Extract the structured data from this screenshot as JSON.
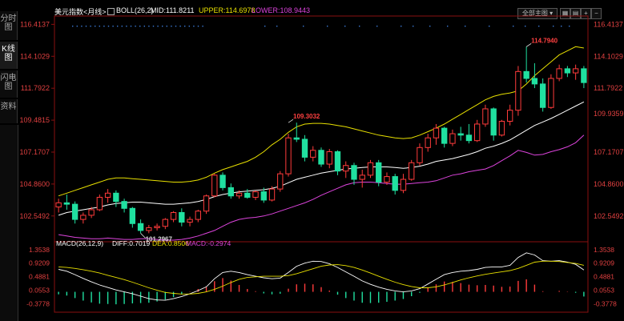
{
  "sidebar": {
    "tabs": [
      {
        "label": "分时图",
        "active": false
      },
      {
        "label": "K线图",
        "active": true
      },
      {
        "label": "闪电图",
        "active": false
      },
      {
        "label": "资料",
        "active": false
      }
    ]
  },
  "header": {
    "symbol": "美元指数<月线>",
    "indicator": "BOLL(26,2)",
    "mid_label": "MID:111.8211",
    "upper_label": "UPPER:114.6978",
    "lower_label": "LOWER:108.9443",
    "dropdown": "全部主图",
    "colors": {
      "mid": "#ffffff",
      "upper": "#e8e000",
      "lower": "#dd44dd"
    }
  },
  "toolbar": {
    "icons": [
      "grid-icon",
      "book-icon",
      "zoom-in-icon",
      "zoom-out-icon"
    ]
  },
  "chart_data": [
    {
      "type": "candlestick",
      "ylim": [
        100.8,
        116.9
      ],
      "yticks_left": [
        "116.4137",
        "114.1029",
        "111.7922",
        "109.4815",
        "107.1707",
        "104.8600",
        "102.5492"
      ],
      "yticks_right": [
        "116.4137",
        "114.1029",
        "111.7922",
        "109.9359",
        "107.1707",
        "104.8600",
        "102.5492"
      ],
      "annotations": [
        {
          "text": "114.7940",
          "index": 57,
          "value": 114.794
        },
        {
          "text": "109.3032",
          "index": 28,
          "value": 109.3032
        },
        {
          "text": "101.2967",
          "index": 10,
          "value": 101.2967
        }
      ],
      "colors": {
        "up": "#ff3b3b",
        "down": "#20e0a0"
      },
      "candles": [
        [
          103.2,
          103.8,
          102.8,
          103.5
        ],
        [
          103.5,
          104.1,
          103.0,
          103.4
        ],
        [
          103.4,
          103.6,
          102.0,
          102.3
        ],
        [
          102.3,
          102.8,
          102.0,
          102.6
        ],
        [
          102.6,
          103.2,
          102.4,
          103.0
        ],
        [
          103.0,
          104.1,
          102.9,
          103.9
        ],
        [
          103.9,
          104.5,
          103.5,
          104.2
        ],
        [
          104.2,
          104.4,
          103.2,
          103.6
        ],
        [
          103.6,
          103.8,
          102.8,
          103.1
        ],
        [
          103.1,
          103.2,
          101.7,
          102.0
        ],
        [
          102.0,
          102.3,
          101.3,
          101.5
        ],
        [
          101.5,
          101.9,
          101.3,
          101.7
        ],
        [
          101.7,
          102.0,
          101.5,
          101.8
        ],
        [
          101.8,
          102.4,
          101.6,
          102.3
        ],
        [
          102.3,
          102.9,
          102.1,
          102.8
        ],
        [
          102.8,
          103.1,
          101.8,
          102.1
        ],
        [
          102.1,
          102.5,
          101.8,
          102.3
        ],
        [
          102.3,
          103.0,
          102.1,
          102.9
        ],
        [
          102.9,
          104.1,
          102.7,
          104.0
        ],
        [
          104.0,
          105.6,
          103.9,
          105.5
        ],
        [
          105.5,
          105.7,
          104.4,
          104.6
        ],
        [
          104.6,
          104.9,
          103.8,
          104.0
        ],
        [
          104.0,
          104.4,
          103.8,
          104.2
        ],
        [
          104.2,
          104.5,
          103.8,
          103.9
        ],
        [
          103.9,
          104.4,
          103.7,
          104.3
        ],
        [
          104.3,
          104.6,
          103.5,
          103.7
        ],
        [
          103.7,
          104.7,
          103.6,
          104.5
        ],
        [
          104.5,
          105.8,
          104.3,
          105.6
        ],
        [
          105.6,
          108.5,
          105.4,
          108.2
        ],
        [
          108.2,
          109.3,
          107.9,
          108.1
        ],
        [
          108.1,
          108.4,
          106.5,
          106.8
        ],
        [
          106.8,
          107.6,
          106.5,
          107.3
        ],
        [
          107.3,
          107.5,
          106.1,
          106.3
        ],
        [
          106.3,
          107.4,
          106.0,
          107.2
        ],
        [
          107.2,
          107.3,
          105.5,
          105.8
        ],
        [
          105.8,
          106.5,
          105.3,
          106.2
        ],
        [
          106.2,
          106.4,
          104.8,
          105.2
        ],
        [
          105.2,
          105.9,
          104.6,
          105.5
        ],
        [
          105.5,
          106.6,
          105.3,
          106.4
        ],
        [
          106.4,
          106.6,
          104.7,
          105.0
        ],
        [
          105.0,
          105.7,
          104.8,
          105.4
        ],
        [
          105.4,
          105.6,
          104.1,
          104.4
        ],
        [
          104.4,
          105.6,
          104.2,
          105.2
        ],
        [
          105.2,
          106.6,
          105.1,
          106.4
        ],
        [
          106.4,
          107.8,
          106.2,
          107.5
        ],
        [
          107.5,
          108.5,
          107.2,
          108.2
        ],
        [
          108.2,
          109.2,
          107.7,
          108.9
        ],
        [
          108.9,
          109.0,
          107.5,
          107.8
        ],
        [
          107.8,
          108.8,
          107.6,
          108.5
        ],
        [
          108.5,
          109.0,
          108.0,
          108.4
        ],
        [
          108.4,
          109.2,
          107.8,
          108.0
        ],
        [
          108.0,
          109.5,
          107.9,
          109.2
        ],
        [
          109.2,
          110.6,
          109.0,
          110.3
        ],
        [
          110.3,
          110.4,
          108.0,
          108.4
        ],
        [
          108.4,
          109.5,
          108.3,
          109.4
        ],
        [
          109.4,
          110.6,
          109.1,
          110.2
        ],
        [
          110.2,
          113.4,
          109.8,
          113.0
        ],
        [
          113.0,
          114.8,
          112.2,
          112.5
        ],
        [
          112.5,
          113.6,
          111.8,
          112.1
        ],
        [
          112.1,
          112.5,
          110.1,
          110.4
        ],
        [
          110.4,
          112.8,
          110.3,
          112.5
        ],
        [
          112.5,
          113.5,
          112.3,
          113.2
        ],
        [
          113.2,
          113.4,
          112.6,
          112.9
        ],
        [
          112.9,
          113.5,
          112.4,
          113.2
        ],
        [
          113.2,
          113.4,
          111.8,
          112.2
        ]
      ],
      "boll_mid": [
        102.6,
        102.8,
        102.9,
        103.0,
        103.1,
        103.2,
        103.35,
        103.45,
        103.5,
        103.55,
        103.55,
        103.5,
        103.45,
        103.4,
        103.4,
        103.45,
        103.5,
        103.6,
        103.75,
        103.95,
        104.1,
        104.2,
        104.3,
        104.35,
        104.4,
        104.45,
        104.55,
        104.7,
        104.95,
        105.2,
        105.35,
        105.5,
        105.65,
        105.75,
        105.85,
        105.95,
        106.0,
        106.05,
        106.1,
        106.1,
        106.1,
        106.05,
        106.0,
        106.05,
        106.15,
        106.3,
        106.5,
        106.6,
        106.7,
        106.85,
        107.0,
        107.2,
        107.45,
        107.6,
        107.8,
        108.05,
        108.4,
        108.75,
        109.1,
        109.35,
        109.6,
        109.9,
        110.2,
        110.5,
        110.8
      ],
      "boll_upper": [
        104.0,
        104.2,
        104.4,
        104.6,
        104.8,
        105.0,
        105.2,
        105.3,
        105.3,
        105.25,
        105.2,
        105.15,
        105.1,
        105.05,
        105.0,
        105.0,
        105.05,
        105.15,
        105.35,
        105.65,
        105.9,
        106.1,
        106.3,
        106.5,
        106.8,
        107.2,
        107.7,
        108.1,
        108.6,
        109.0,
        109.2,
        109.25,
        109.25,
        109.2,
        109.1,
        109.0,
        108.85,
        108.7,
        108.55,
        108.4,
        108.3,
        108.2,
        108.15,
        108.2,
        108.4,
        108.65,
        108.9,
        109.2,
        109.55,
        109.9,
        110.25,
        110.6,
        110.95,
        111.2,
        111.35,
        111.45,
        111.6,
        112.1,
        112.7,
        113.2,
        113.7,
        114.2,
        114.5,
        114.8,
        114.7
      ],
      "boll_lower": [
        101.2,
        101.1,
        101.0,
        100.95,
        100.9,
        100.9,
        100.95,
        100.9,
        100.85,
        100.85,
        100.9,
        100.9,
        100.85,
        100.8,
        100.8,
        100.85,
        100.95,
        101.1,
        101.3,
        101.5,
        101.8,
        102.1,
        102.3,
        102.4,
        102.45,
        102.55,
        102.7,
        102.9,
        103.1,
        103.3,
        103.5,
        103.75,
        104.05,
        104.3,
        104.55,
        104.8,
        104.95,
        105.0,
        105.0,
        104.95,
        104.9,
        104.85,
        104.85,
        104.9,
        104.95,
        105.0,
        105.1,
        105.3,
        105.5,
        105.6,
        105.75,
        105.85,
        105.95,
        106.2,
        106.55,
        106.9,
        107.3,
        107.15,
        106.95,
        107.0,
        107.2,
        107.35,
        107.55,
        107.85,
        108.4
      ]
    },
    {
      "type": "macd",
      "title": "MACD(26,12,9)",
      "diff_label": "DIFF:0.7019",
      "dea_label": "DEA:0.8506",
      "macd_label": "MACD:-0.2974",
      "ylim": [
        -0.55,
        1.45
      ],
      "yticks": [
        "1.3538",
        "0.9209",
        "0.4881",
        "0.0553",
        "-0.3778"
      ],
      "colors": {
        "diff": "#ffffff",
        "dea": "#e8e000",
        "macd_label": "#dd44dd",
        "up": "#ff3b3b",
        "down": "#20e0a0"
      },
      "diff": [
        0.72,
        0.66,
        0.55,
        0.43,
        0.32,
        0.22,
        0.14,
        0.06,
        0.0,
        -0.06,
        -0.14,
        -0.22,
        -0.26,
        -0.27,
        -0.22,
        -0.15,
        -0.06,
        0.04,
        0.16,
        0.42,
        0.62,
        0.66,
        0.62,
        0.55,
        0.5,
        0.45,
        0.42,
        0.44,
        0.62,
        0.82,
        0.92,
        0.98,
        0.97,
        0.9,
        0.78,
        0.64,
        0.5,
        0.35,
        0.24,
        0.15,
        0.08,
        0.03,
        0.0,
        0.03,
        0.1,
        0.25,
        0.4,
        0.55,
        0.62,
        0.66,
        0.68,
        0.72,
        0.78,
        0.8,
        0.8,
        0.85,
        1.1,
        1.25,
        1.18,
        1.0,
        0.98,
        1.0,
        0.95,
        0.88,
        0.7
      ],
      "dea": [
        0.8,
        0.78,
        0.75,
        0.71,
        0.66,
        0.6,
        0.53,
        0.46,
        0.39,
        0.31,
        0.22,
        0.13,
        0.05,
        -0.02,
        -0.05,
        -0.07,
        -0.07,
        -0.05,
        0.0,
        0.08,
        0.18,
        0.3,
        0.4,
        0.46,
        0.48,
        0.5,
        0.5,
        0.5,
        0.52,
        0.58,
        0.66,
        0.74,
        0.82,
        0.86,
        0.87,
        0.84,
        0.78,
        0.7,
        0.6,
        0.5,
        0.4,
        0.31,
        0.23,
        0.17,
        0.13,
        0.13,
        0.16,
        0.22,
        0.3,
        0.38,
        0.45,
        0.51,
        0.56,
        0.6,
        0.64,
        0.68,
        0.75,
        0.85,
        0.95,
        0.98,
        0.98,
        0.97,
        0.94,
        0.91,
        0.85
      ],
      "macd": [
        -0.16,
        -0.24,
        -0.4,
        -0.56,
        -0.68,
        -0.76,
        -0.78,
        -0.8,
        -0.78,
        -0.74,
        -0.72,
        -0.7,
        -0.62,
        -0.5,
        -0.34,
        -0.16,
        0.02,
        0.18,
        0.32,
        0.68,
        0.88,
        0.72,
        0.44,
        0.18,
        0.04,
        -0.1,
        -0.16,
        -0.12,
        0.2,
        0.48,
        0.52,
        0.48,
        0.3,
        0.08,
        -0.18,
        -0.4,
        -0.56,
        -0.7,
        -0.72,
        -0.7,
        -0.64,
        -0.56,
        -0.46,
        -0.28,
        -0.06,
        0.24,
        0.48,
        0.66,
        0.64,
        0.56,
        0.46,
        0.42,
        0.44,
        0.4,
        0.32,
        0.34,
        0.7,
        0.8,
        0.46,
        0.04,
        0.0,
        0.06,
        0.02,
        -0.06,
        -0.3
      ]
    }
  ]
}
